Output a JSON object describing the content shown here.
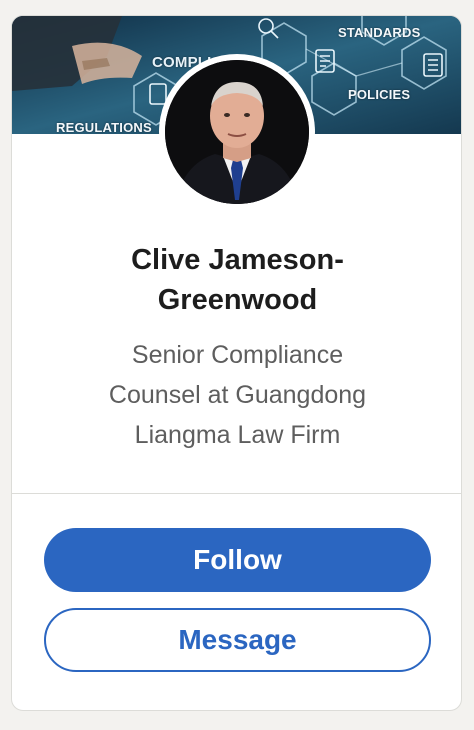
{
  "banner": {
    "words": {
      "standards": "STANDARDS",
      "policies": "POLICIES",
      "regulations": "REGULATIONS",
      "compliance": "COMPLIANCE"
    }
  },
  "profile": {
    "name_line1": "Clive Jameson-",
    "name_line2": "Greenwood",
    "headline_line1": "Senior Compliance",
    "headline_line2": "Counsel at Guangdong",
    "headline_line3": "Liangma Law Firm"
  },
  "actions": {
    "follow_label": "Follow",
    "message_label": "Message"
  },
  "colors": {
    "accent": "#2b66c1",
    "background": "#f3f2ef",
    "card": "#ffffff",
    "name_text": "#1d1d1d",
    "headline_text": "#5e5e5e"
  }
}
